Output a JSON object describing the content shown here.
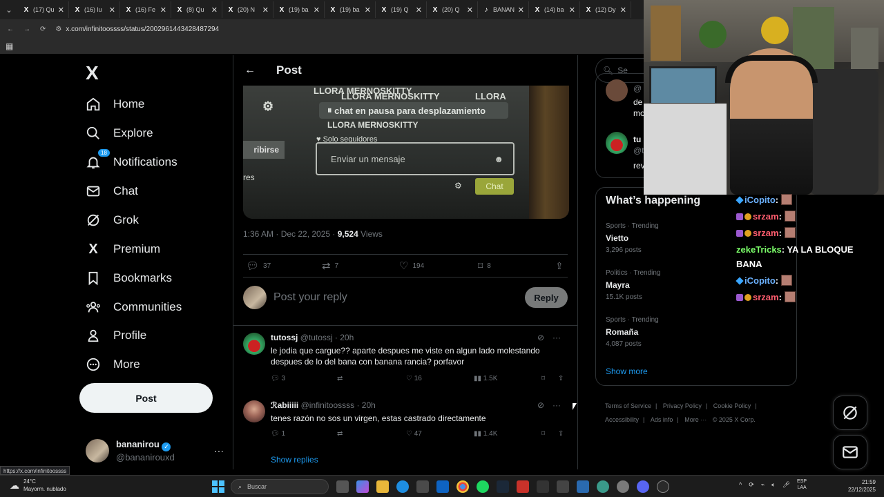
{
  "browser": {
    "tabs": [
      {
        "icon": "X",
        "title": "(17) Qu"
      },
      {
        "icon": "X",
        "title": "(16) lu"
      },
      {
        "icon": "X",
        "title": "(16) Fe"
      },
      {
        "icon": "X",
        "title": "(8) Qu"
      },
      {
        "icon": "X",
        "title": "(20) N"
      },
      {
        "icon": "X",
        "title": "(19) ba"
      },
      {
        "icon": "X",
        "title": "(19) ba"
      },
      {
        "icon": "X",
        "title": "(19) Q"
      },
      {
        "icon": "X",
        "title": "(20) Q"
      },
      {
        "icon": "♪",
        "title": "BANAN"
      },
      {
        "icon": "X",
        "title": "(14) ba"
      },
      {
        "icon": "X",
        "title": "(12) Dy"
      }
    ],
    "url": "x.com/infinitoossss/status/2002961443428487294",
    "status_url": "https://x.com/infinitoossss"
  },
  "nav": {
    "logo": "X",
    "items": [
      {
        "label": "Home",
        "icon": "home-icon"
      },
      {
        "label": "Explore",
        "icon": "search-icon"
      },
      {
        "label": "Notifications",
        "icon": "bell-icon",
        "badge": "18"
      },
      {
        "label": "Chat",
        "icon": "envelope-icon"
      },
      {
        "label": "Grok",
        "icon": "grok-icon"
      },
      {
        "label": "Premium",
        "icon": "x-icon"
      },
      {
        "label": "Bookmarks",
        "icon": "bookmark-icon"
      },
      {
        "label": "Communities",
        "icon": "people-icon"
      },
      {
        "label": "Profile",
        "icon": "person-icon"
      },
      {
        "label": "More",
        "icon": "more-circle-icon"
      }
    ],
    "post_button": "Post",
    "account": {
      "name": "bananirou",
      "handle": "@bananirouxd"
    }
  },
  "post": {
    "header_title": "Post",
    "media": {
      "lines": [
        "LLORA MERNOSKITTY",
        "LLORA MERNOSKITTY",
        "LLORA",
        "LLORA MERNOSKITTY"
      ],
      "pause": "chat en pausa para desplazamiento",
      "followers": "Solo seguidores",
      "message_placeholder": "Enviar un mensaje",
      "chat_button": "Chat",
      "subscribe": "ribirse",
      "res": "res"
    },
    "time": "1:36 AM · Dec 22, 2025 ·",
    "views_count": "9,524",
    "views_label": "Views",
    "stats": {
      "replies": "37",
      "reposts": "7",
      "likes": "194",
      "bookmarks": "8"
    },
    "reply_placeholder": "Post your reply",
    "reply_button": "Reply"
  },
  "replies": [
    {
      "name": "tutossj",
      "handle": "@tutossj · 20h",
      "text": "le jodia que cargue?? aparte despues me viste en algun lado molestando despues de lo del bana con banana rancia? porfavor",
      "replies": "3",
      "likes": "16",
      "views": "1.5K"
    },
    {
      "name": "ℛabiiiii",
      "handle": "@infinitoossss · 20h",
      "text": "tenes razón no sos un virgen, estas castrado directamente",
      "replies": "1",
      "likes": "47",
      "views": "1.4K"
    }
  ],
  "show_replies": "Show replies",
  "right": {
    "search_placeholder": "Se",
    "who": [
      {
        "handle": "@",
        "line": "de",
        "line2": "mo"
      },
      {
        "handle": "tu",
        "line": "@t",
        "line2": "rev"
      }
    ],
    "happening_title": "What’s happening",
    "trends": [
      {
        "category": "Sports · Trending",
        "name": "Vietto",
        "count": "3,296 posts"
      },
      {
        "category": "Politics · Trending",
        "name": "Mayra",
        "count": "15.1K posts"
      },
      {
        "category": "Sports · Trending",
        "name": "Romaña",
        "count": "4,087 posts"
      }
    ],
    "show_more": "Show more",
    "footer": [
      "Terms of Service",
      "Privacy Policy",
      "Cookie Policy",
      "Accessibility",
      "Ads info",
      "More ···",
      "© 2025 X Corp."
    ]
  },
  "stream_chat": [
    {
      "user": "iCopito",
      "text": ":",
      "color": "u1"
    },
    {
      "user": "srzam",
      "text": ":",
      "color": "u2"
    },
    {
      "user": "srzam",
      "text": ":",
      "color": "u2"
    },
    {
      "user": "zekeTricks",
      "text": ": YA LA BLOQUE",
      "color": "u3"
    },
    {
      "user": "",
      "text": "BANA",
      "color": "u3"
    },
    {
      "user": "iCopito",
      "text": ":",
      "color": "u1"
    },
    {
      "user": "srzam",
      "text": ":",
      "color": "u2"
    }
  ],
  "taskbar": {
    "weather_temp": "24°C",
    "weather_desc": "Mayorm. nublado",
    "search": "Buscar",
    "lang": "ESP",
    "lang2": "LAA",
    "time": "21:59",
    "date": "22/12/2025"
  }
}
